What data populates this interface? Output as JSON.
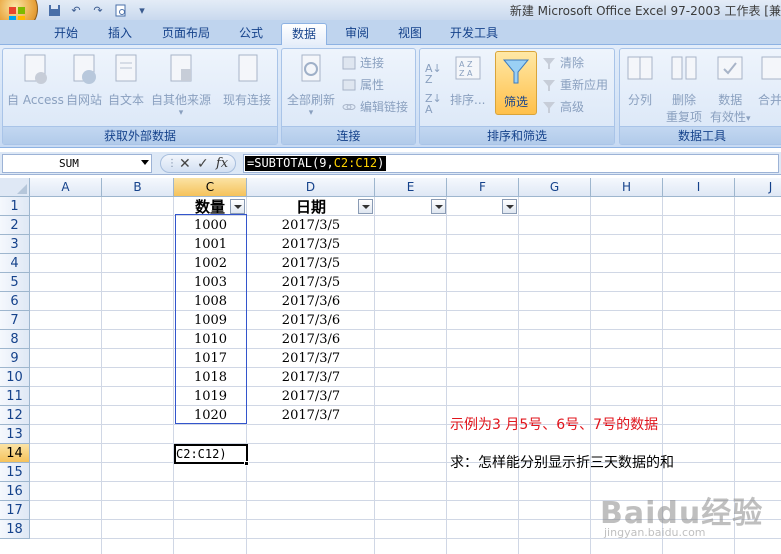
{
  "window": {
    "title": "新建 Microsoft Office Excel 97-2003 工作表 [兼"
  },
  "tabs": [
    "开始",
    "插入",
    "页面布局",
    "公式",
    "数据",
    "审阅",
    "视图",
    "开发工具"
  ],
  "active_tab": "数据",
  "ribbon": {
    "groups": {
      "external": {
        "label": "获取外部数据",
        "buttons": [
          "自 Access",
          "自网站",
          "自文本",
          "自其他来源",
          "现有连接"
        ]
      },
      "connections": {
        "label": "连接",
        "refresh_all": "全部刷新",
        "small": [
          "连接",
          "属性",
          "编辑链接"
        ]
      },
      "sort_filter": {
        "label": "排序和筛选",
        "sort": "排序...",
        "filter": "筛选",
        "small": [
          "清除",
          "重新应用",
          "高级"
        ]
      },
      "tools": {
        "label": "数据工具",
        "split": "分列",
        "remove_dup_1": "删除",
        "remove_dup_2": "重复项",
        "validation_1": "数据",
        "validation_2": "有效性",
        "consolidate": "合并"
      }
    }
  },
  "formula_bar": {
    "name_box": "SUM",
    "formula_prefix": "=SUBTOTAL(9,",
    "formula_ref": "C2:C12",
    "formula_suffix": ")",
    "icons": [
      "cancel-icon",
      "enter-icon",
      "fx-icon"
    ]
  },
  "sheet": {
    "columns": [
      "A",
      "B",
      "C",
      "D",
      "E",
      "F",
      "G",
      "H",
      "I",
      "J"
    ],
    "rows": [
      "1",
      "2",
      "3",
      "4",
      "5",
      "6",
      "7",
      "8",
      "9",
      "10",
      "11",
      "12",
      "13",
      "14",
      "15",
      "16",
      "17",
      "18"
    ],
    "selected_column": "C",
    "selected_row": "14",
    "header_quantity": "数量",
    "header_date": "日期",
    "data_rows": [
      {
        "qty": "1000",
        "date": "2017/3/5"
      },
      {
        "qty": "1001",
        "date": "2017/3/5"
      },
      {
        "qty": "1002",
        "date": "2017/3/5"
      },
      {
        "qty": "1003",
        "date": "2017/3/5"
      },
      {
        "qty": "1008",
        "date": "2017/3/6"
      },
      {
        "qty": "1009",
        "date": "2017/3/6"
      },
      {
        "qty": "1010",
        "date": "2017/3/6"
      },
      {
        "qty": "1017",
        "date": "2017/3/7"
      },
      {
        "qty": "1018",
        "date": "2017/3/7"
      },
      {
        "qty": "1019",
        "date": "2017/3/7"
      },
      {
        "qty": "1020",
        "date": "2017/3/7"
      }
    ],
    "active_cell_text": "C2:C12)",
    "note_red": "示例为3 月5号、6号、7号的数据",
    "note_black": "求：怎样能分别显示折三天数据的和"
  },
  "colors": {
    "note_red": "#e0141c",
    "selection_border": "#3355cc",
    "formula_ref": "#ffd200"
  },
  "watermark": {
    "brand": "Baidu经验",
    "url": "jingyan.baidu.com"
  }
}
